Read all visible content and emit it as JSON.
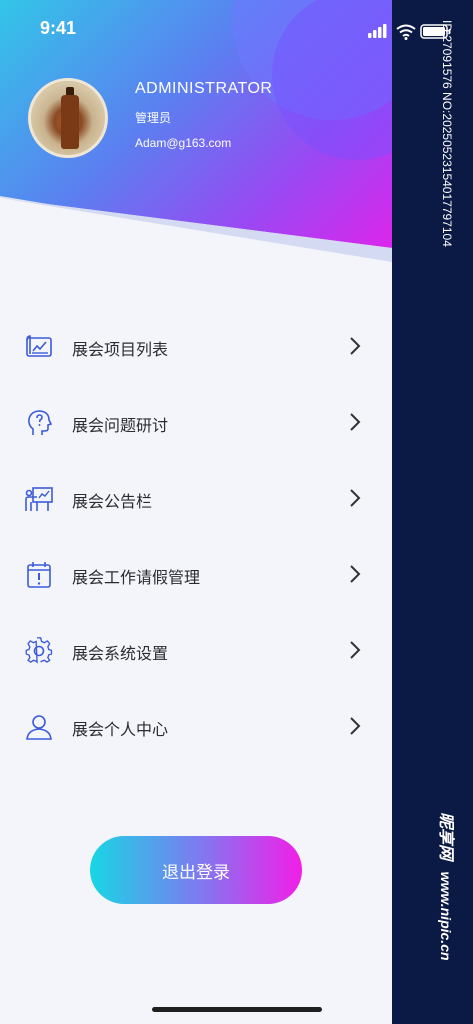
{
  "status_bar": {
    "time": "9:41"
  },
  "profile": {
    "name": "ADMINISTRATOR",
    "role": "管理员",
    "email": "Adam@g163.com"
  },
  "menu": {
    "items": [
      {
        "label": "展会项目列表",
        "icon": "chart-board-icon"
      },
      {
        "label": "展会问题研讨",
        "icon": "head-question-icon"
      },
      {
        "label": "展会公告栏",
        "icon": "presentation-icon"
      },
      {
        "label": "展会工作请假管理",
        "icon": "calendar-alert-icon"
      },
      {
        "label": "展会系统设置",
        "icon": "gear-icon"
      },
      {
        "label": "展会个人中心",
        "icon": "user-icon"
      }
    ]
  },
  "logout_label": "退出登录",
  "watermark": {
    "id_text": "ID:27091576 NO:20250523154017797104",
    "brand": "昵享网",
    "url": "www.nipic.cn"
  },
  "colors": {
    "accent_start": "#18d6e4",
    "accent_end": "#f31ee8",
    "icon_blue": "#3b5bd9",
    "side_panel": "#0b1a45"
  }
}
